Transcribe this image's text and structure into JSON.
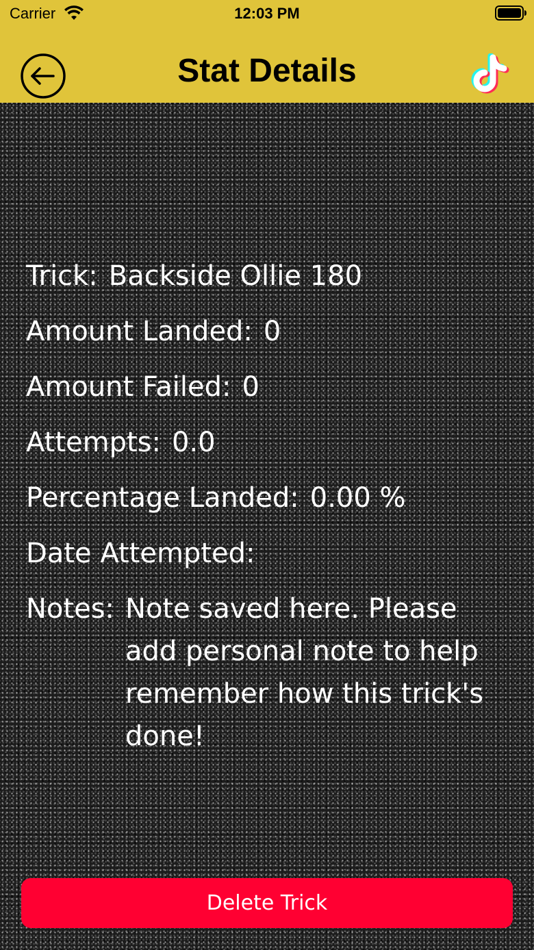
{
  "status_bar": {
    "carrier": "Carrier",
    "time": "12:03 PM",
    "icons": [
      "wifi-icon",
      "battery-icon"
    ]
  },
  "nav": {
    "title": "Stat Details",
    "back_icon": "back-arrow-circle-icon",
    "right_icon": "tiktok-icon"
  },
  "stats": {
    "trick_label": "Trick:",
    "trick_value": "Backside Ollie 180",
    "landed_label": "Amount Landed:",
    "landed_value": "0",
    "failed_label": "Amount Failed:",
    "failed_value": "0",
    "attempts_label": "Attempts:",
    "attempts_value": "0.0",
    "percentage_label": "Percentage Landed:",
    "percentage_value": "0.00 %",
    "date_label": "Date Attempted:",
    "date_value": "",
    "notes_label": "Notes:",
    "notes_value": "Note saved here. Please add personal note to help remember how this trick's done!"
  },
  "actions": {
    "delete_label": "Delete Trick"
  },
  "colors": {
    "header": "#e0c43a",
    "delete_button": "#ff0032",
    "text": "#ffffff",
    "background": "#1c1c1c"
  }
}
